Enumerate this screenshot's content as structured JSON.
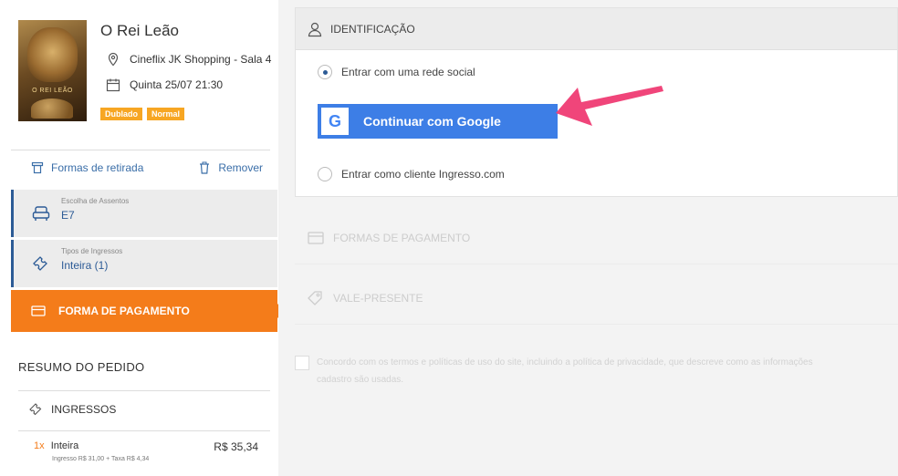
{
  "movie": {
    "title": "O Rei Leão",
    "cinema": "Cineflix JK Shopping - Sala 4",
    "date": "Quinta 25/07 21:30",
    "badges": [
      "Dublado",
      "Normal"
    ],
    "poster_text": "O REI LEÃO"
  },
  "actions": {
    "pickup": "Formas de retirada",
    "remove": "Remover"
  },
  "steps": [
    {
      "label": "Escolha de Assentos",
      "value": "E7"
    },
    {
      "label": "Tipos de Ingressos",
      "value": "Inteira (1)"
    }
  ],
  "active_step": "FORMA DE PAGAMENTO",
  "summary": {
    "title": "RESUMO DO PEDIDO",
    "section": "INGRESSOS",
    "item_qty": "1x",
    "item_name": "Inteira",
    "item_price": "R$ 35,34",
    "item_detail": "Ingresso R$ 31,00 + Taxa R$ 4,34"
  },
  "identification": {
    "header": "IDENTIFICAÇÃO",
    "option_social": "Entrar com uma rede social",
    "google_button": "Continuar com Google",
    "google_glyph": "G",
    "option_client": "Entrar como cliente Ingresso.com"
  },
  "sections": {
    "payment": "FORMAS DE PAGAMENTO",
    "voucher": "VALE-PRESENTE"
  },
  "terms": {
    "line1": "Concordo com os termos e políticas de uso do site, incluindo a política de privacidade, que descreve como as informações",
    "line2": "cadastro são usadas."
  },
  "colors": {
    "orange": "#f47c1a",
    "blue": "#2c5b96",
    "google_blue": "#3d7ee6",
    "badge": "#f7a623",
    "annotation_arrow": "#f0457a"
  },
  "icons": {
    "location": "location-pin-icon",
    "calendar": "calendar-icon",
    "pickup": "ticket-pickup-icon",
    "trash": "trash-icon",
    "seat": "seat-icon",
    "ticket": "ticket-icon",
    "card": "credit-card-icon",
    "user": "user-icon",
    "gift": "gift-tag-icon"
  }
}
